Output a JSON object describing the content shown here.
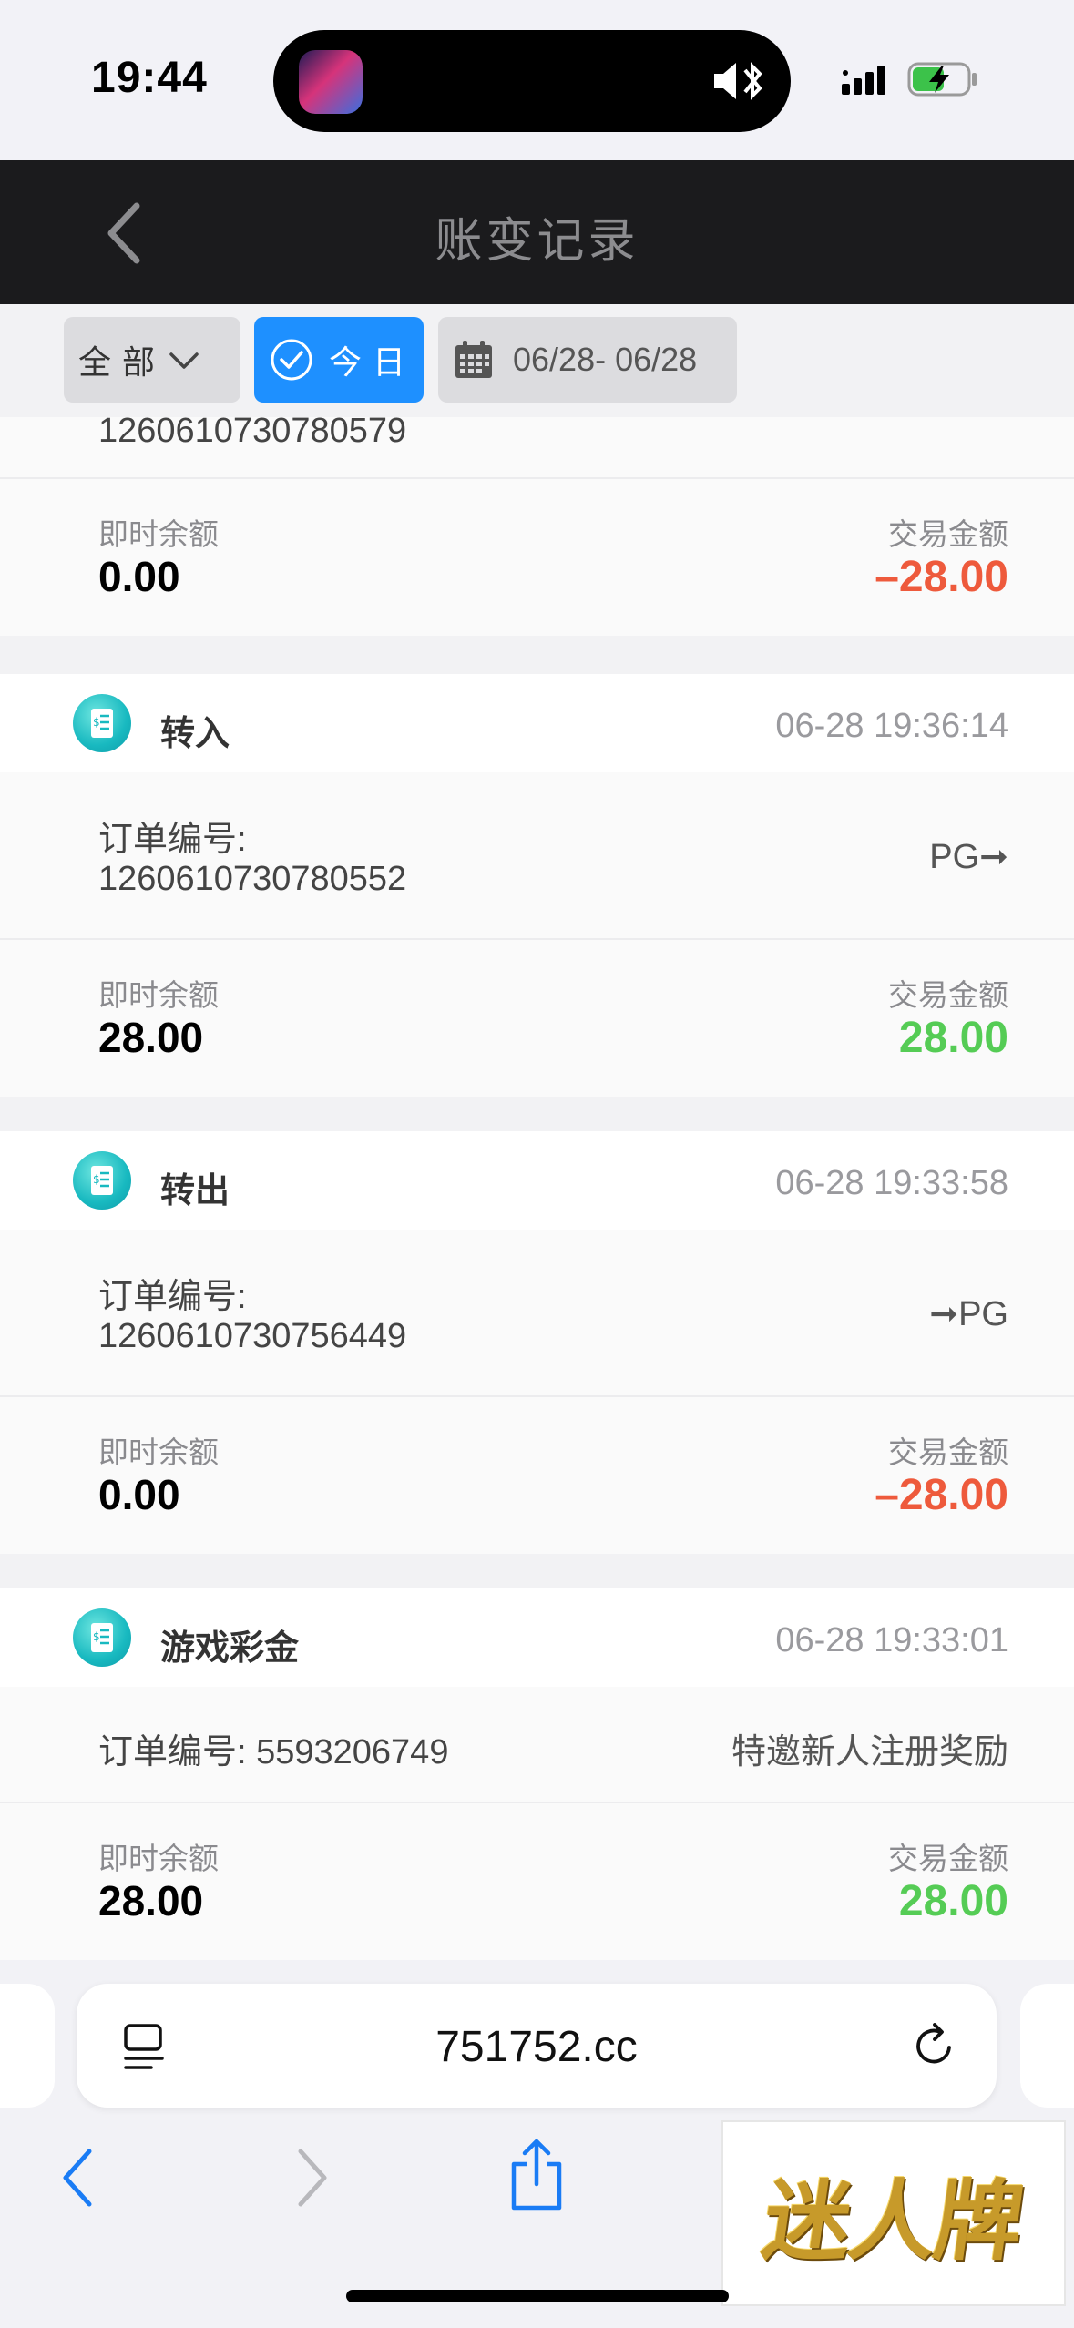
{
  "status_bar": {
    "time": "19:44"
  },
  "header": {
    "title": "账变记录"
  },
  "filters": {
    "all_label": "全部",
    "today_label": "今日",
    "date_range": "06/28- 06/28"
  },
  "labels": {
    "order_label": "订单编号:",
    "balance_label": "即时余额",
    "amount_label": "交易金额"
  },
  "partial_top": {
    "order_no": "1260610730780579",
    "balance": "0.00",
    "amount": "–28.00"
  },
  "records": [
    {
      "type": "转入",
      "time": "06-28 19:36:14",
      "order_no": "1260610730780552",
      "note": "PG➞",
      "balance": "28.00",
      "amount": "28.00"
    },
    {
      "type": "转出",
      "time": "06-28 19:33:58",
      "order_no": "1260610730756449",
      "note": "➞PG",
      "balance": "0.00",
      "amount": "–28.00"
    },
    {
      "type": "游戏彩金",
      "time": "06-28 19:33:01",
      "order_inline": "订单编号: 5593206749",
      "note": "特邀新人注册奖励",
      "balance": "28.00",
      "amount": "28.00"
    }
  ],
  "browser": {
    "url": "751752.cc"
  },
  "watermark": {
    "text": "迷人牌"
  },
  "colors": {
    "negative": "#ee5a3c",
    "positive": "#55cc55",
    "accent": "#1e90ff",
    "header_bg": "#1b1b1d"
  }
}
